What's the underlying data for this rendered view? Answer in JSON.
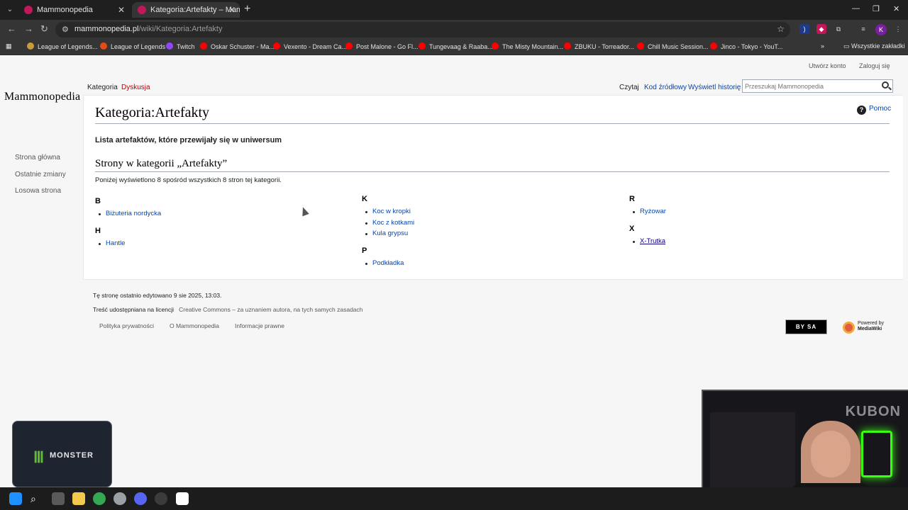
{
  "browser": {
    "tabs": [
      {
        "title": "Mammonopedia",
        "close": "✕"
      },
      {
        "title": "Kategoria:Artefakty – Mammon",
        "close": "✕"
      }
    ],
    "new_tab": "+",
    "url_host": "mammonopedia.pl",
    "url_path": "/wiki/Kategoria:Artefakty",
    "bookmarks": [
      "League of Legends...",
      "League of Legends",
      "Twitch",
      "Oskar Schuster - Ma...",
      "Vexento - Dream Ca...",
      "Post Malone - Go Fl...",
      "Tungevaag & Raaba...",
      "The Misty Mountain...",
      "ZBUKU - Torreador...",
      "Chill Music Session...",
      "Jinco - Tokyo - YouT..."
    ],
    "all_bookmarks": "Wszystkie zakładki",
    "profile_initial": "K"
  },
  "wiki": {
    "personal": {
      "create_account": "Utwórz konto",
      "login": "Zaloguj się"
    },
    "logo": "Mammonopedia",
    "sidebar": [
      "Strona główna",
      "Ostatnie zmiany",
      "Losowa strona"
    ],
    "tabs": {
      "category": "Kategoria",
      "discussion": "Dyskusja",
      "read": "Czytaj",
      "source": "Kod źródłowy",
      "history": "Wyświetl historię"
    },
    "search_placeholder": "Przeszukaj Mammonopedia",
    "title": "Kategoria:Artefakty",
    "help": "Pomoc",
    "description": "Lista artefaktów, które przewijały się w uniwersum",
    "subheading": "Strony w kategorii „Artefakty”",
    "count_text": "Poniżej wyświetlono 8 spośród wszystkich 8 stron tej kategorii.",
    "groups": [
      {
        "letter": "B",
        "items": [
          "Biżuteria nordycka"
        ]
      },
      {
        "letter": "H",
        "items": [
          "Hantle"
        ]
      },
      {
        "letter": "K",
        "items": [
          "Koc w kropki",
          "Koc z kotkami",
          "Kula grypsu"
        ]
      },
      {
        "letter": "P",
        "items": [
          "Podkładka"
        ]
      },
      {
        "letter": "R",
        "items": [
          "Ryżowar"
        ]
      },
      {
        "letter": "X",
        "items": [
          "X-Trutka"
        ]
      }
    ],
    "footer": {
      "last_edited": "Tę stronę ostatnio edytowano 9 sie 2025, 13:03.",
      "license_prefix": "Treść udostępniana na licencji",
      "license_name": "Creative Commons – za uznaniem autora, na tych samych zasadach",
      "links": [
        "Polityka prywatności",
        "O Mammonopedia",
        "Informacje prawne"
      ],
      "cc_badge": "BY SA",
      "powered_by": "Powered by",
      "mediawiki": "MediaWiki"
    }
  },
  "overlay": {
    "webcam_brand": "KUBON",
    "monster_text": "MONSTER"
  }
}
